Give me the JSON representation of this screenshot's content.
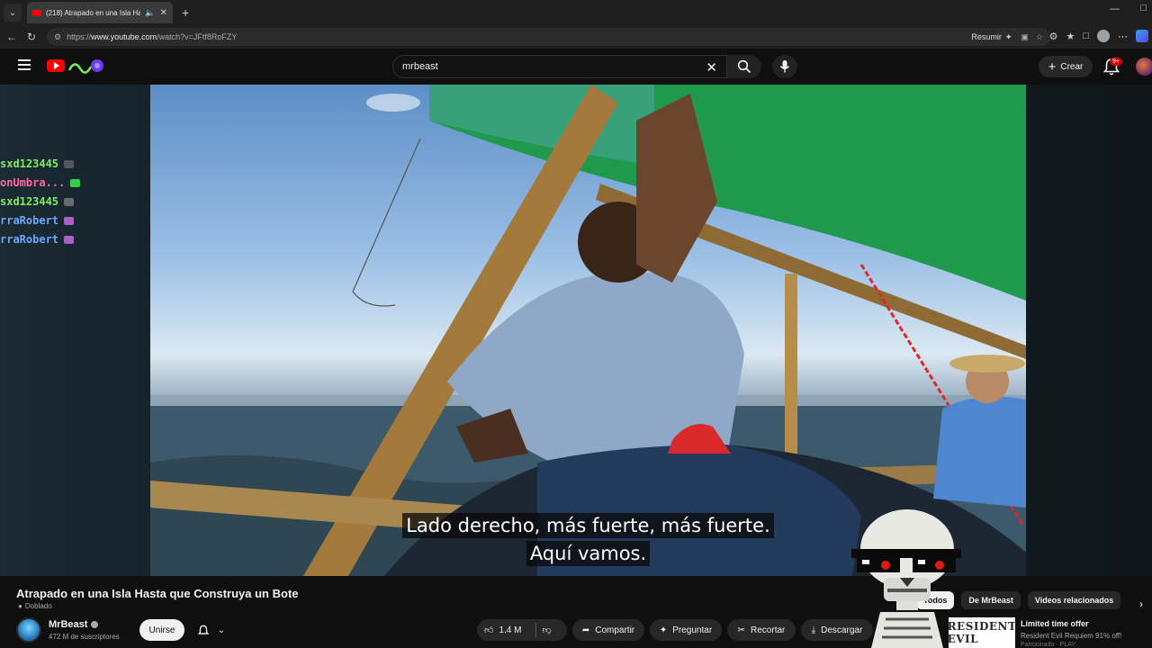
{
  "browser": {
    "tab_title": "(218) Atrapado en una Isla Ha",
    "url_prefix": "https://",
    "url_host": "www.youtube.com",
    "url_path": "/watch?v=JFtf8RoFZY",
    "resumir_label": "Resumir"
  },
  "youtube": {
    "search_value": "mrbeast",
    "crear_label": "Crear",
    "notif_count": "9+"
  },
  "chat": [
    {
      "user": "sxd123445",
      "color": "#7cf05a",
      "emote_color": "#555555"
    },
    {
      "user": "onUmbra...",
      "color": "#ff6aa0",
      "emote_color": "#2fd04a"
    },
    {
      "user": "sxd123445",
      "color": "#7cf05a",
      "emote_color": "#6a6a6a"
    },
    {
      "user": "rraRobert",
      "color": "#6aa8ff",
      "emote_color": "#b05acb"
    },
    {
      "user": "rraRobert",
      "color": "#6aa8ff",
      "emote_color": "#b05acb"
    }
  ],
  "captions": {
    "line1": "Lado derecho, más fuerte, más fuerte.",
    "line2": "Aquí vamos."
  },
  "video": {
    "title": "Atrapado en una Isla Hasta que Construya un Bote",
    "dub_label": "Doblado"
  },
  "channel": {
    "name": "MrBeast",
    "subs": "472 M de suscriptores",
    "join_label": "Unirse"
  },
  "actions": {
    "likes": "1.4 M",
    "share": "Compartir",
    "ask": "Preguntar",
    "cut": "Recortar",
    "download": "Descargar"
  },
  "chips": [
    "Todos",
    "De MrBeast",
    "Videos relacionados"
  ],
  "ad": {
    "thumb_text": "RESIDENT EVIL",
    "title": "Limited time offer",
    "subtitle": "Resident Evil Requiem 91% off!",
    "sponsor": "Patrocinado · PLAY"
  },
  "colors": {
    "yt_red": "#ff0000",
    "background": "#0f0f0f",
    "pill": "#272727"
  }
}
